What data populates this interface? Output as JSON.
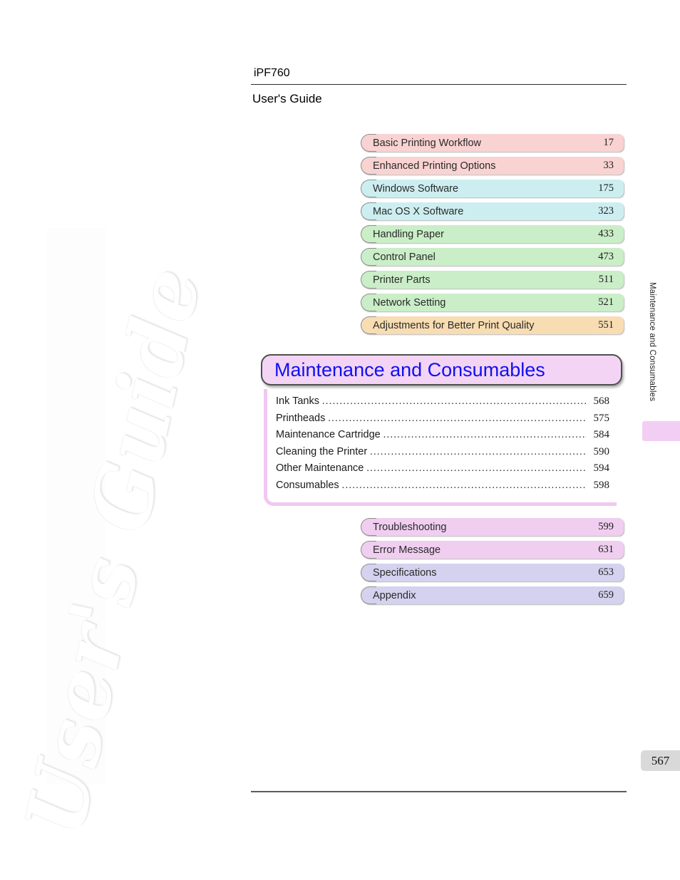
{
  "header": {
    "model": "iPF760",
    "subtitle": "User's Guide"
  },
  "watermark": {
    "text": "User's Guide"
  },
  "chapters_top": [
    {
      "label": "Basic Printing Workflow",
      "page": "17",
      "color_class": "c-pink",
      "color": "#f9d2d2"
    },
    {
      "label": "Enhanced Printing Options",
      "page": "33",
      "color_class": "c-pink",
      "color": "#f9d2d2"
    },
    {
      "label": "Windows Software",
      "page": "175",
      "color_class": "c-cyan",
      "color": "#cdeef0"
    },
    {
      "label": "Mac OS X Software",
      "page": "323",
      "color_class": "c-cyan",
      "color": "#cdeef0"
    },
    {
      "label": "Handling Paper",
      "page": "433",
      "color_class": "c-green",
      "color": "#caeec7"
    },
    {
      "label": "Control Panel",
      "page": "473",
      "color_class": "c-green",
      "color": "#caeec7"
    },
    {
      "label": "Printer Parts",
      "page": "511",
      "color_class": "c-green",
      "color": "#caeec7"
    },
    {
      "label": "Network Setting",
      "page": "521",
      "color_class": "c-green",
      "color": "#caeec7"
    },
    {
      "label": "Adjustments for Better Print Quality",
      "page": "551",
      "color_class": "c-orange",
      "color": "#f8ddb2"
    }
  ],
  "current_section": {
    "title": "Maintenance and Consumables",
    "title_color": "#1111ee",
    "background": "#f3d4f5",
    "entries": [
      {
        "label": "Ink Tanks",
        "page": "568"
      },
      {
        "label": "Printheads",
        "page": "575"
      },
      {
        "label": "Maintenance Cartridge",
        "page": "584"
      },
      {
        "label": "Cleaning the Printer",
        "page": "590"
      },
      {
        "label": "Other Maintenance",
        "page": "594"
      },
      {
        "label": "Consumables",
        "page": "598"
      }
    ]
  },
  "chapters_bottom": [
    {
      "label": "Troubleshooting",
      "page": "599",
      "color_class": "c-violet",
      "color": "#f0cef0"
    },
    {
      "label": "Error Message",
      "page": "631",
      "color_class": "c-violet",
      "color": "#f0cef0"
    },
    {
      "label": "Specifications",
      "page": "653",
      "color_class": "c-blue",
      "color": "#d4d2ee"
    },
    {
      "label": "Appendix",
      "page": "659",
      "color_class": "c-blue",
      "color": "#d4d2ee"
    }
  ],
  "side_tab": {
    "label": "Maintenance and Consumables",
    "marker_color": "#f2cef4"
  },
  "footer": {
    "page_number": "567"
  },
  "dots": "....................................................................................................................."
}
